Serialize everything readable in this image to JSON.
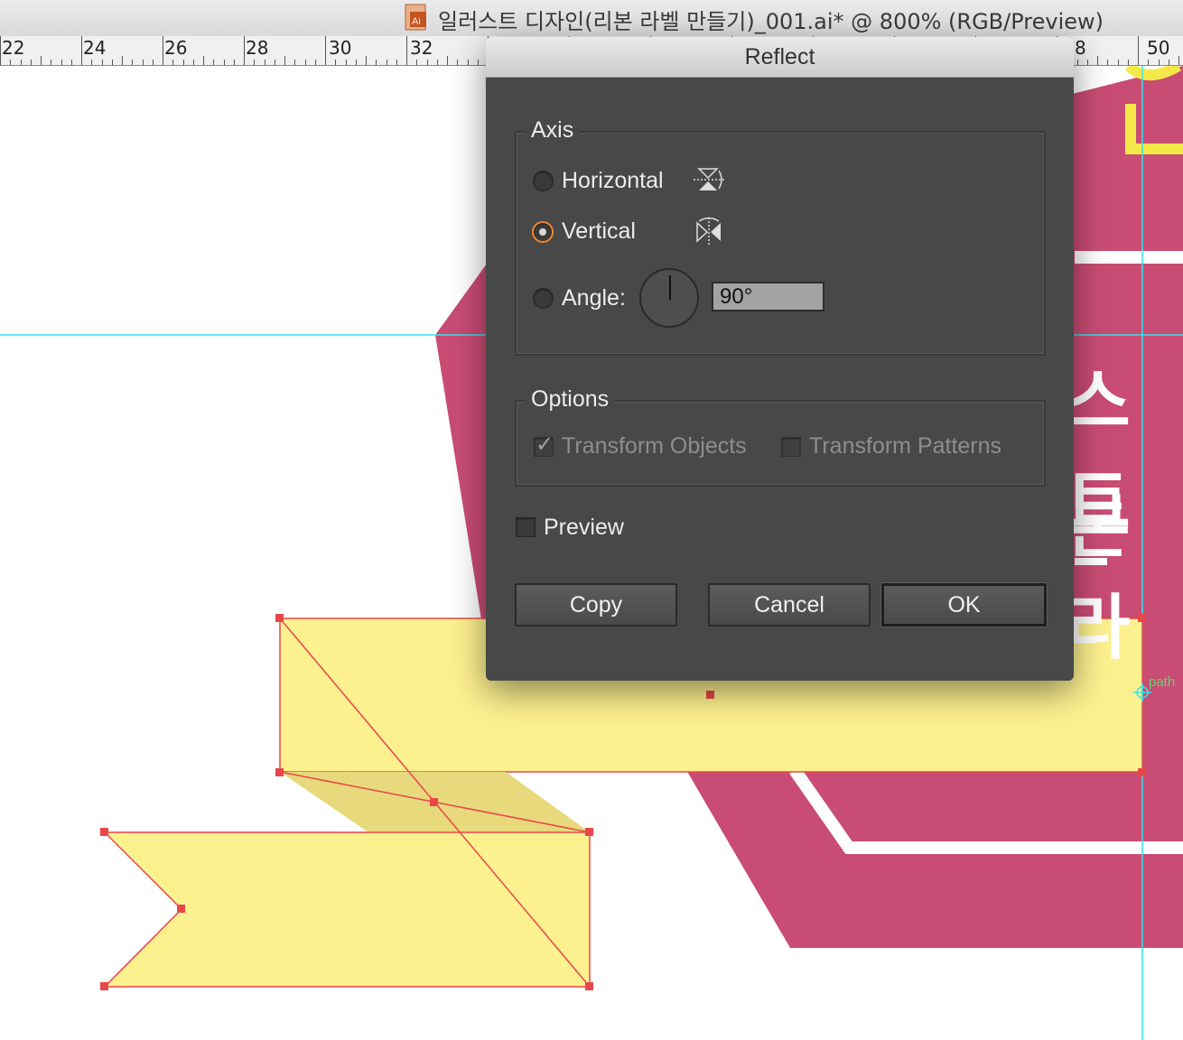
{
  "window": {
    "title": "일러스트 디자인(리본 라벨 만들기)_001.ai* @ 800% (RGB/Preview)",
    "icon_label": "Ai"
  },
  "ruler": {
    "labels": [
      "22",
      "24",
      "26",
      "28",
      "30",
      "32",
      "8",
      "50"
    ]
  },
  "canvas": {
    "path_label": "path",
    "artwork_glyphs": [
      "스트",
      "본 라"
    ],
    "colors": {
      "guide": "#2ee6ee",
      "magenta": "#c94c74",
      "ribbon_yellow": "#fdf08f",
      "ribbon_fold": "#e8d97c",
      "selection": "#e8474a",
      "accent_yellow": "#f5e94a"
    }
  },
  "dialog": {
    "title": "Reflect",
    "axis": {
      "legend": "Axis",
      "horizontal_label": "Horizontal",
      "vertical_label": "Vertical",
      "angle_label": "Angle:",
      "angle_value": "90°",
      "selected": "vertical"
    },
    "options": {
      "legend": "Options",
      "transform_objects_label": "Transform Objects",
      "transform_patterns_label": "Transform Patterns",
      "transform_objects_checked": true,
      "transform_patterns_checked": false
    },
    "preview_label": "Preview",
    "preview_checked": false,
    "buttons": {
      "copy": "Copy",
      "cancel": "Cancel",
      "ok": "OK"
    },
    "colors": {
      "radio_focus": "#f0872d"
    }
  }
}
